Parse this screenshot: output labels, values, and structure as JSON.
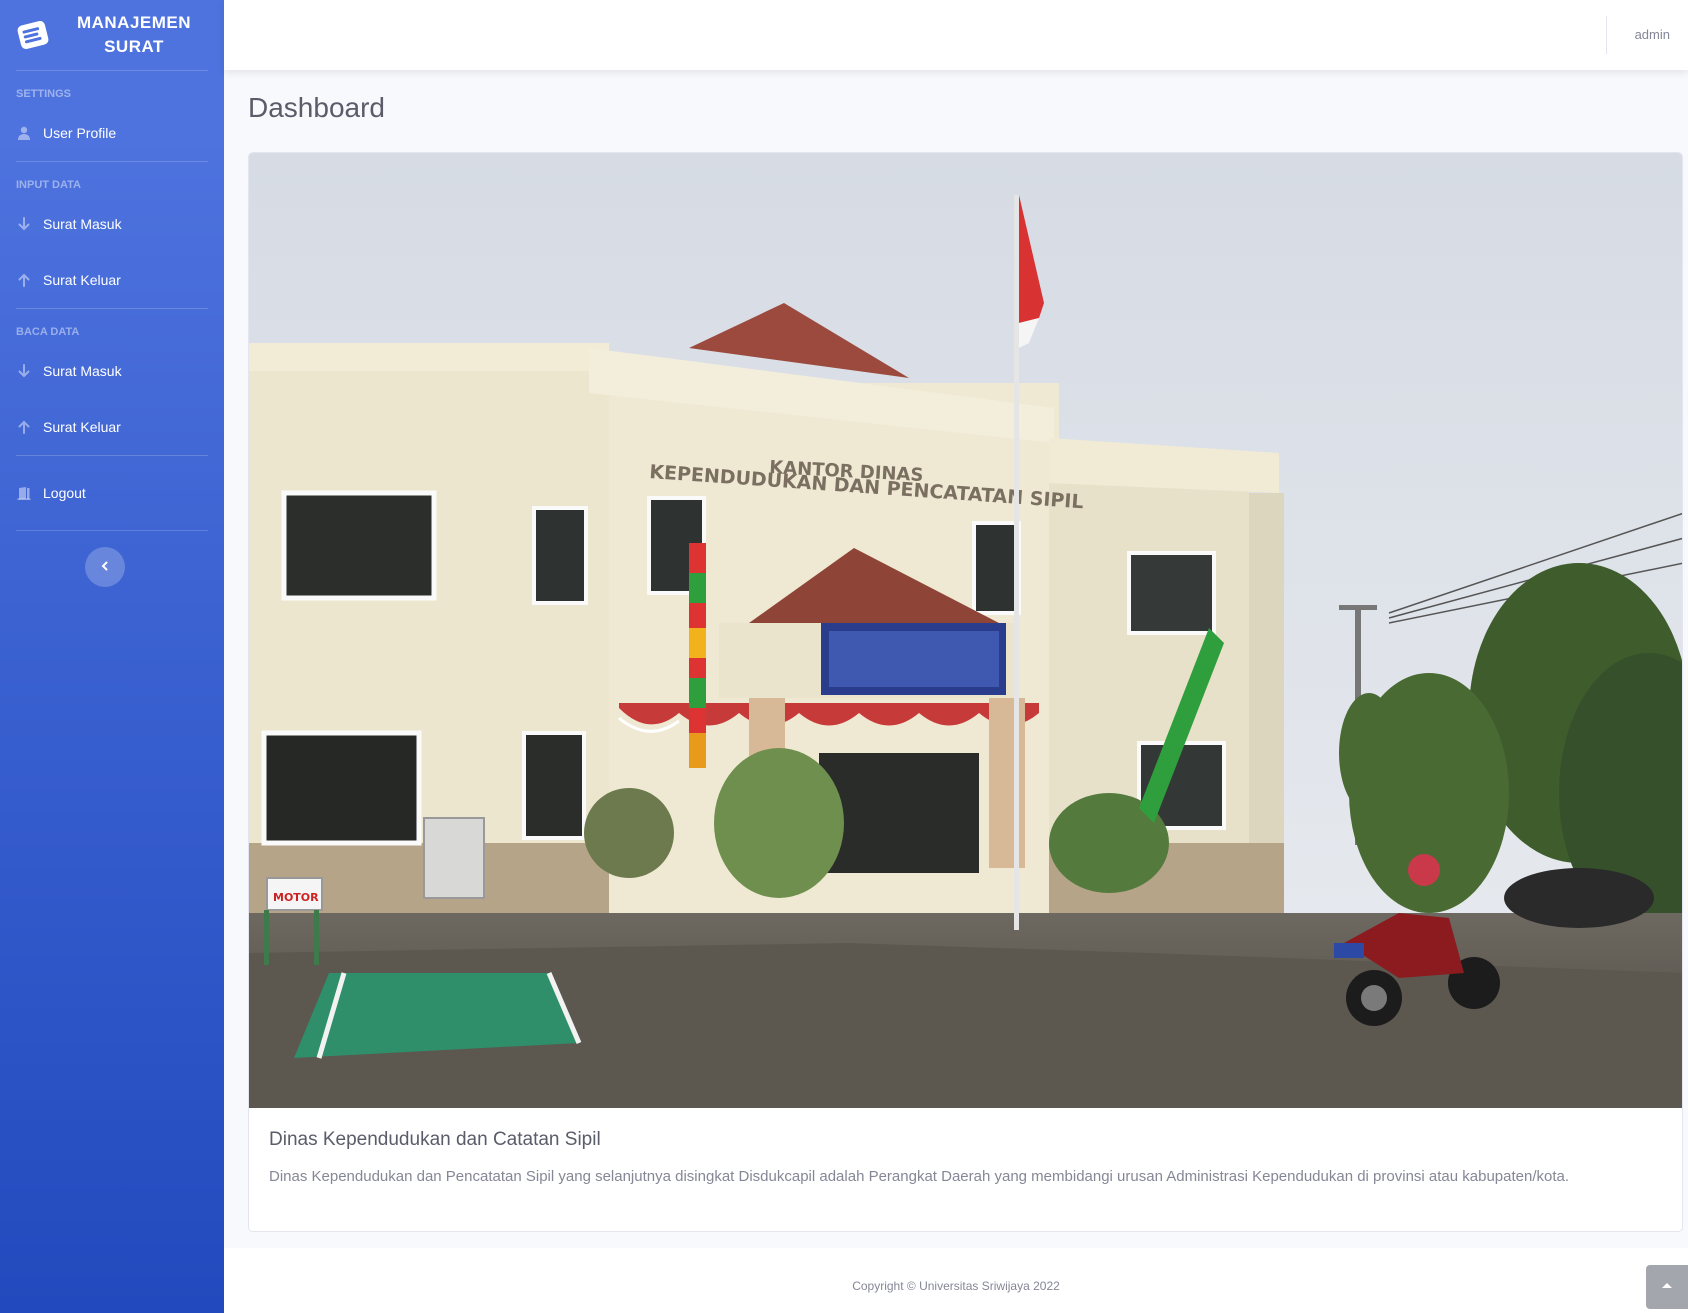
{
  "brand": {
    "line1": "MANAJEMEN",
    "line2": "SURAT",
    "logo_icon": "envelope-icon"
  },
  "sidebar": {
    "settings_heading": "SETTINGS",
    "user_profile": {
      "label": "User Profile",
      "icon": "user-icon"
    },
    "input_heading": "INPUT DATA",
    "input_masuk": {
      "label": "Surat Masuk",
      "icon": "arrow-down-icon"
    },
    "input_keluar": {
      "label": "Surat Keluar",
      "icon": "arrow-up-icon"
    },
    "baca_heading": "BACA DATA",
    "baca_masuk": {
      "label": "Surat Masuk",
      "icon": "arrow-down-icon"
    },
    "baca_keluar": {
      "label": "Surat Keluar",
      "icon": "arrow-up-icon"
    },
    "logout": {
      "label": "Logout",
      "icon": "door-icon"
    },
    "toggle_icon": "chevron-left-icon"
  },
  "topbar": {
    "user": "admin"
  },
  "main": {
    "title": "Dashboard",
    "card": {
      "sign_line1": "KANTOR   DINAS",
      "sign_line2": "KEPENDUDUKAN DAN PENCATATAN SIPIL",
      "parking_sign": "MOTOR",
      "title": "Dinas Kependudukan dan Catatan Sipil",
      "text": "Dinas Kependudukan dan Pencatatan Sipil yang selanjutnya disingkat Disdukcapil adalah Perangkat Daerah yang membidangi urusan Administrasi Kependudukan di provinsi atau kabupaten/kota."
    }
  },
  "footer": {
    "copyright": "Copyright © Universitas Sriwijaya 2022"
  },
  "colors": {
    "primary": "#4e73df",
    "primary_dark": "#224abe",
    "text": "#5a5c69",
    "muted": "#858796"
  }
}
